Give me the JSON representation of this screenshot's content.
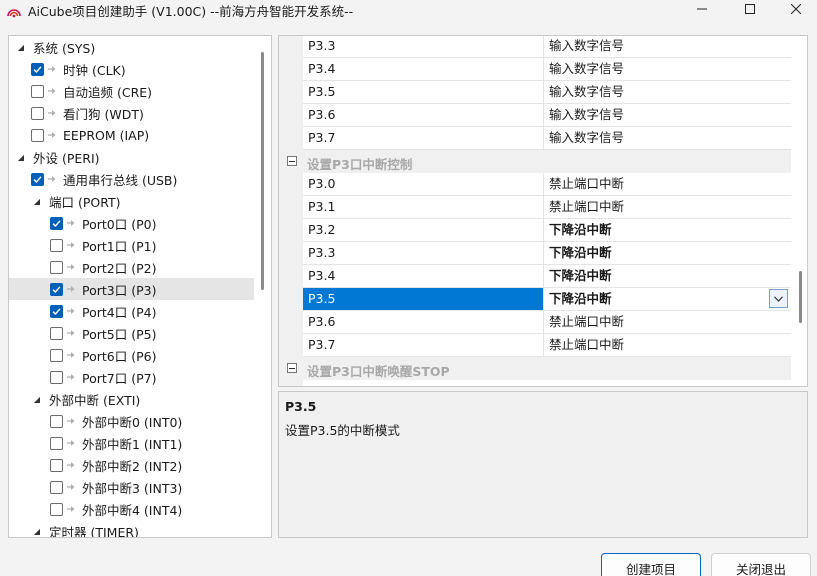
{
  "window": {
    "title": "AiCube项目创建助手 (V1.00C) --前海方舟智能开发系统--",
    "icons": {
      "app": "aicube-logo-icon",
      "minimize": "minimize-icon",
      "maximize": "maximize-icon",
      "close": "close-icon"
    }
  },
  "tree": {
    "items": [
      {
        "label": "系统 (SYS)",
        "expander": "expanded",
        "checkbox": false,
        "checked": false
      },
      {
        "label": "时钟 (CLK)",
        "expander": "none",
        "checkbox": true,
        "checked": true
      },
      {
        "label": "自动追频 (CRE)",
        "expander": "none",
        "checkbox": true,
        "checked": false
      },
      {
        "label": "看门狗 (WDT)",
        "expander": "none",
        "checkbox": true,
        "checked": false
      },
      {
        "label": "EEPROM (IAP)",
        "expander": "none",
        "checkbox": true,
        "checked": false
      },
      {
        "label": "外设 (PERI)",
        "expander": "expanded",
        "checkbox": false,
        "checked": false
      },
      {
        "label": "通用串行总线 (USB)",
        "expander": "none",
        "checkbox": true,
        "checked": true
      },
      {
        "label": "端口 (PORT)",
        "expander": "expanded",
        "checkbox": false,
        "checked": false
      },
      {
        "label": "Port0口 (P0)",
        "expander": "none",
        "checkbox": true,
        "checked": true
      },
      {
        "label": "Port1口 (P1)",
        "expander": "none",
        "checkbox": true,
        "checked": false
      },
      {
        "label": "Port2口 (P2)",
        "expander": "none",
        "checkbox": true,
        "checked": false
      },
      {
        "label": "Port3口 (P3)",
        "expander": "none",
        "checkbox": true,
        "checked": true,
        "selected": true
      },
      {
        "label": "Port4口 (P4)",
        "expander": "none",
        "checkbox": true,
        "checked": true
      },
      {
        "label": "Port5口 (P5)",
        "expander": "none",
        "checkbox": true,
        "checked": false
      },
      {
        "label": "Port6口 (P6)",
        "expander": "none",
        "checkbox": true,
        "checked": false
      },
      {
        "label": "Port7口 (P7)",
        "expander": "none",
        "checkbox": true,
        "checked": false
      },
      {
        "label": "外部中断 (EXTI)",
        "expander": "expanded",
        "checkbox": false,
        "checked": false
      },
      {
        "label": "外部中断0 (INT0)",
        "expander": "none",
        "checkbox": true,
        "checked": false
      },
      {
        "label": "外部中断1 (INT1)",
        "expander": "none",
        "checkbox": true,
        "checked": false
      },
      {
        "label": "外部中断2 (INT2)",
        "expander": "none",
        "checkbox": true,
        "checked": false
      },
      {
        "label": "外部中断3 (INT3)",
        "expander": "none",
        "checkbox": true,
        "checked": false
      },
      {
        "label": "外部中断4 (INT4)",
        "expander": "none",
        "checkbox": true,
        "checked": false
      },
      {
        "label": "定时器 (TIMER)",
        "expander": "expanded",
        "checkbox": false,
        "checked": false
      }
    ]
  },
  "grid": {
    "rows": [
      {
        "type": "prop",
        "name": "P3.3",
        "value": "输入数字信号",
        "bold": false
      },
      {
        "type": "prop",
        "name": "P3.4",
        "value": "输入数字信号",
        "bold": false
      },
      {
        "type": "prop",
        "name": "P3.5",
        "value": "输入数字信号",
        "bold": false
      },
      {
        "type": "prop",
        "name": "P3.6",
        "value": "输入数字信号",
        "bold": false
      },
      {
        "type": "prop",
        "name": "P3.7",
        "value": "输入数字信号",
        "bold": false
      },
      {
        "type": "category",
        "name": "设置P3口中断控制"
      },
      {
        "type": "prop",
        "name": "P3.0",
        "value": "禁止端口中断",
        "bold": false
      },
      {
        "type": "prop",
        "name": "P3.1",
        "value": "禁止端口中断",
        "bold": false
      },
      {
        "type": "prop",
        "name": "P3.2",
        "value": "下降沿中断",
        "bold": true
      },
      {
        "type": "prop",
        "name": "P3.3",
        "value": "下降沿中断",
        "bold": true
      },
      {
        "type": "prop",
        "name": "P3.4",
        "value": "下降沿中断",
        "bold": true
      },
      {
        "type": "prop",
        "name": "P3.5",
        "value": "下降沿中断",
        "bold": true,
        "selected": true
      },
      {
        "type": "prop",
        "name": "P3.6",
        "value": "禁止端口中断",
        "bold": false
      },
      {
        "type": "prop",
        "name": "P3.7",
        "value": "禁止端口中断",
        "bold": false
      },
      {
        "type": "category",
        "name": "设置P3口中断唤醒STOP"
      }
    ],
    "dropdown_icon": "chevron-down-icon"
  },
  "description": {
    "title": "P3.5",
    "text": "设置P3.5的中断模式"
  },
  "buttons": {
    "create": "创建项目",
    "close": "关闭退出"
  },
  "colors": {
    "accent": "#0078d4",
    "checkbox": "#005fb8",
    "category_text": "#a8a8a8"
  }
}
